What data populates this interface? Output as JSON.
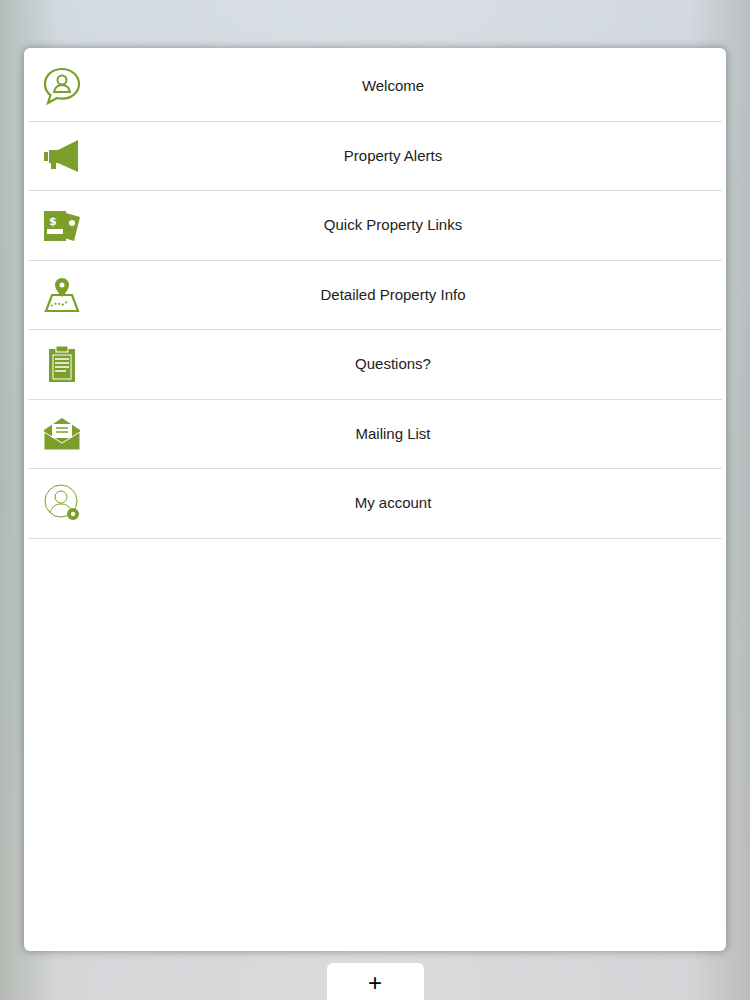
{
  "menu": {
    "items": [
      {
        "label": "Welcome"
      },
      {
        "label": "Property Alerts"
      },
      {
        "label": "Quick Property Links"
      },
      {
        "label": "Detailed Property Info"
      },
      {
        "label": "Questions?"
      },
      {
        "label": "Mailing List"
      },
      {
        "label": "My account"
      }
    ]
  },
  "add_button": {
    "label": "+"
  }
}
